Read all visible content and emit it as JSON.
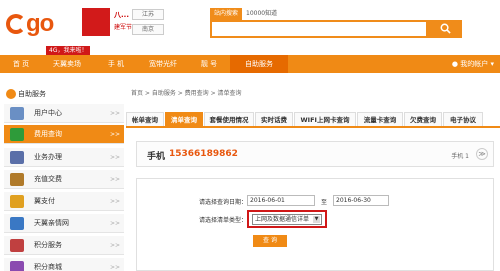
{
  "header": {
    "logo_text": "go",
    "flag_line1": "八...",
    "flag_line2": "建军节",
    "city_1": "江苏",
    "city_2": "南京",
    "promo": "4G，我来啦！",
    "search_tabs": [
      "站内搜索",
      "10000知道"
    ],
    "search_button_icon": "magnifier-icon"
  },
  "nav": {
    "items": [
      "首 页",
      "天翼卖场",
      "手 机",
      "宽带光纤",
      "靓 号",
      "自助服务"
    ],
    "active_index": 5,
    "right_label": "我的帐户"
  },
  "sidebar": {
    "title": "自助服务",
    "items": [
      {
        "label": "用户中心",
        "icon": "user-icon",
        "color": "#6a8fc4"
      },
      {
        "label": "费用查询",
        "icon": "search-icon",
        "color": "#2e9b3a"
      },
      {
        "label": "业务办理",
        "icon": "grid-icon",
        "color": "#5a6fa8"
      },
      {
        "label": "充值交费",
        "icon": "card-icon",
        "color": "#b07a2a"
      },
      {
        "label": "翼支付",
        "icon": "wallet-icon",
        "color": "#e0a020"
      },
      {
        "label": "天翼亲情网",
        "icon": "network-icon",
        "color": "#3a78c4"
      },
      {
        "label": "积分服务",
        "icon": "points-icon",
        "color": "#c04040"
      },
      {
        "label": "积分商城",
        "icon": "mall-icon",
        "color": "#8a4ab0"
      }
    ],
    "active_index": 1,
    "arrow": ">>"
  },
  "breadcrumb": "首页 > 自助服务 > 费用查询 > 清单查询",
  "tabs": {
    "items": [
      "帐单查询",
      "清单查询",
      "套餐使用情况",
      "实时话费",
      "WIFI上网卡查询",
      "流量卡查询",
      "欠费查询",
      "电子协议"
    ],
    "active_index": 1
  },
  "phone": {
    "label": "手机",
    "number": "15366189862",
    "right_text": "手机 1",
    "toggle": "≫"
  },
  "query": {
    "date_label": "请选择查询日期：",
    "start_date": "2016-06-01",
    "sep": "至",
    "end_date": "2016-06-30",
    "type_label": "请选择清单类型：",
    "type_value": "上网及数据通信详单",
    "button": "查 询"
  },
  "colors": {
    "accent": "#f08a15",
    "highlight": "#d01818",
    "phone_number": "#e8570e"
  }
}
